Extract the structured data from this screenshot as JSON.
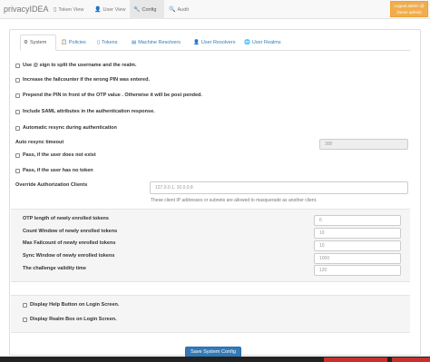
{
  "nav": {
    "brand": "privacyIDEA",
    "items": [
      {
        "label": "Token View",
        "icon": "tablet-icon"
      },
      {
        "label": "User View",
        "icon": "user-icon"
      },
      {
        "label": "Config",
        "icon": "wrench-icon"
      },
      {
        "label": "Audit",
        "icon": "search-icon"
      }
    ],
    "logout_line1": "Logout admin @",
    "logout_line2": "(None admin)"
  },
  "tabs": [
    {
      "label": "System"
    },
    {
      "label": "Policies"
    },
    {
      "label": "Tokens"
    },
    {
      "label": "Machine Resolvers"
    },
    {
      "label": "User Resolvers"
    },
    {
      "label": "User Realms"
    }
  ],
  "options": {
    "split_at": "Use @ sign to split the username and the realm.",
    "failcounter": "Increase the failcounter if the wrong PIN was entered.",
    "prepend_pin": "Prepend the PIN in front of the OTP value . Otherwise it will be post pended.",
    "saml": "Include SAML attributes in the authentication response.",
    "auto_resync": "Automatic resync during authentication",
    "auto_resync_timeout_label": "Auto resync timeout",
    "auto_resync_timeout_value": "300",
    "pass_no_user": "Pass, if the user does not exist",
    "pass_no_token": "Pass, if the user has no token",
    "override_label": "Override Authorization Clients",
    "override_placeholder": "127.0.0.1, 10.0.0.8",
    "override_help": "These client IP addresses or subnets are allowed to masquerade as another client."
  },
  "token_defaults": {
    "otp_length_label": "OTP length of newly enrolled tokens",
    "otp_length_value": "6",
    "count_window_label": "Count Window of newly enrolled tokens",
    "count_window_value": "10",
    "max_failcount_label": "Max Failcount of newly enrolled tokens",
    "max_failcount_value": "10",
    "sync_window_label": "Sync Window of newly enrolled tokens",
    "sync_window_value": "1000",
    "challenge_validity_label": "The challenge validity time",
    "challenge_validity_value": "120"
  },
  "login_screen": {
    "help_button": "Display Help Button on Login Screen.",
    "realm_box": "Display Realm Box on Login Screen."
  },
  "save_label": "Save System Config",
  "colors": {
    "primary": "#337ab7",
    "warning": "#f0ad4e",
    "danger": "#c9302c"
  }
}
